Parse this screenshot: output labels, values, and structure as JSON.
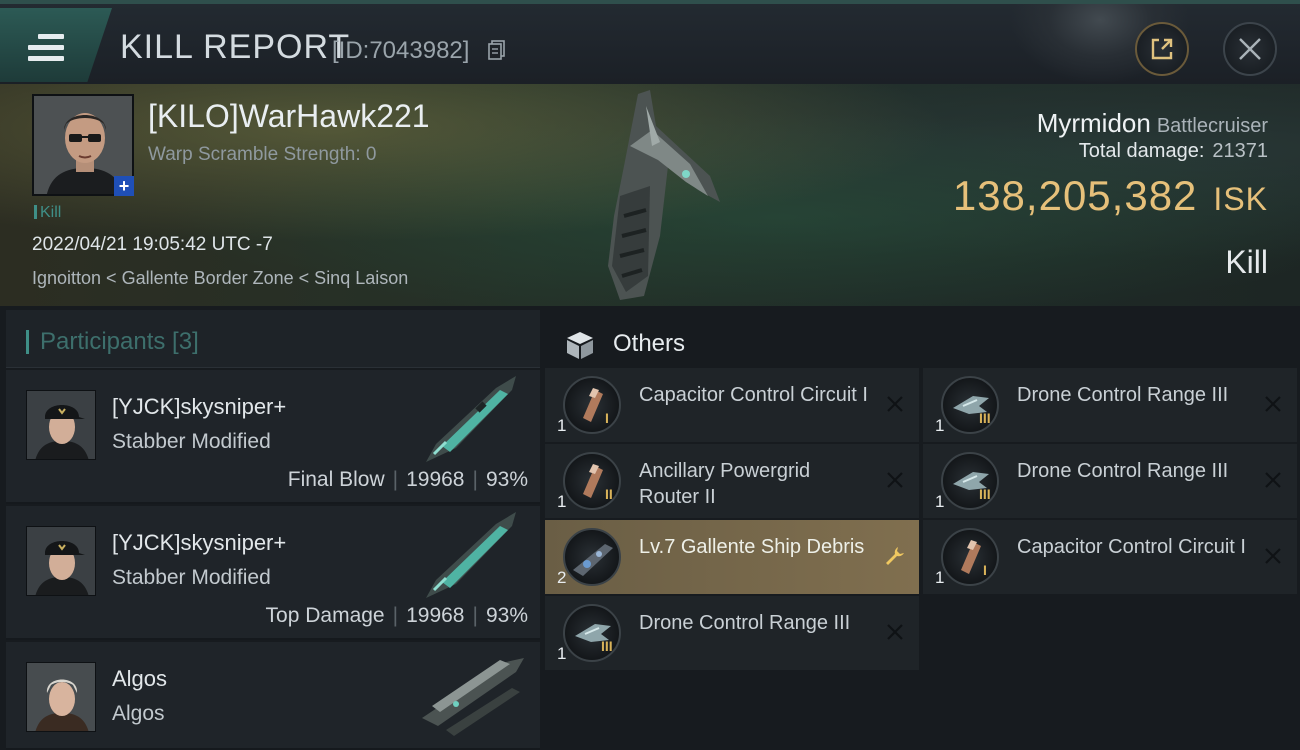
{
  "header": {
    "title": "KILL REPORT",
    "report_id": "[ID:7043982]"
  },
  "victim": {
    "name": "[KILO]WarHawk221",
    "warp_scramble": "Warp Scramble Strength: 0",
    "tag": "Kill",
    "datetime": "2022/04/21 19:05:42 UTC -7",
    "location": "Ignoitton < Gallente Border Zone < Sinq Laison",
    "ship_name": "Myrmidon",
    "ship_class": "Battlecruiser",
    "total_damage_label": "Total damage:",
    "total_damage": "21371",
    "isk_value": "138,205,382",
    "isk_unit": "ISK",
    "result": "Kill"
  },
  "participants": {
    "title": "Participants [3]",
    "items": [
      {
        "name": "[YJCK]skysniper+",
        "ship": "Stabber Modified",
        "role": "Final Blow",
        "damage": "19968",
        "percent": "93%"
      },
      {
        "name": "[YJCK]skysniper+",
        "ship": "Stabber Modified",
        "role": "Top Damage",
        "damage": "19968",
        "percent": "93%"
      },
      {
        "name": "Algos",
        "ship": "Algos",
        "role": "",
        "damage": "",
        "percent": ""
      }
    ]
  },
  "others": {
    "title": "Others",
    "items": [
      {
        "qty": "1",
        "tier": "I",
        "name": "Capacitor Control Circuit I",
        "icon": "capacitor-icon",
        "action": "destroyed"
      },
      {
        "qty": "1",
        "tier": "III",
        "name": "Drone Control Range III",
        "icon": "drone-icon",
        "action": "destroyed"
      },
      {
        "qty": "1",
        "tier": "II",
        "name": "Ancillary Powergrid Router II",
        "icon": "capacitor-icon",
        "action": "destroyed"
      },
      {
        "qty": "1",
        "tier": "III",
        "name": "Drone Control Range III",
        "icon": "drone-icon",
        "action": "destroyed"
      },
      {
        "qty": "2",
        "tier": "",
        "name": "Lv.7 Gallente Ship Debris",
        "icon": "debris-icon",
        "action": "salvage"
      },
      {
        "qty": "1",
        "tier": "I",
        "name": "Capacitor Control Circuit I",
        "icon": "capacitor-icon",
        "action": "destroyed"
      },
      {
        "qty": "1",
        "tier": "III",
        "name": "Drone Control Range III",
        "icon": "drone-icon",
        "action": "destroyed"
      }
    ]
  },
  "colors": {
    "accent_teal": "#3f8f87",
    "isk_gold": "#e6c07a",
    "highlight_row": "#806f4f"
  }
}
